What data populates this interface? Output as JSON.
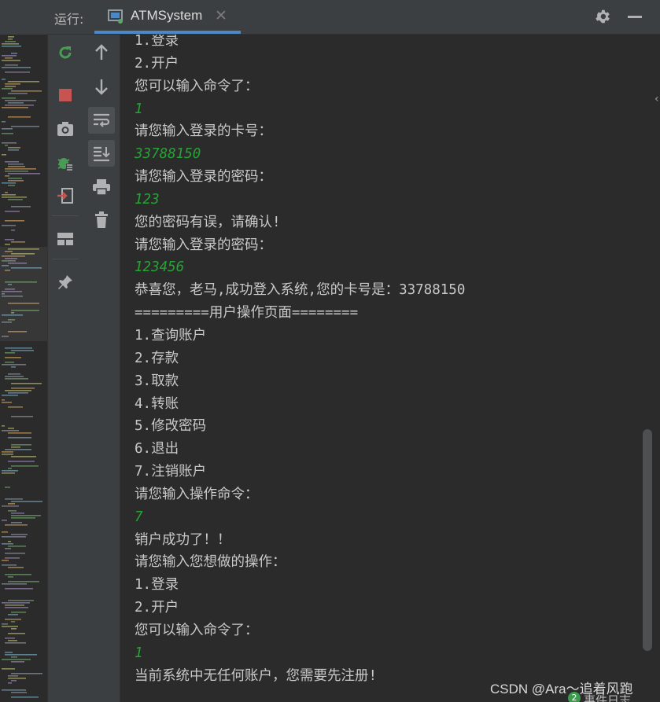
{
  "header": {
    "run_label": "运行:",
    "tab_title": "ATMSystem",
    "tab_close": "✕"
  },
  "icons": {
    "rerun": "rerun-icon",
    "stop": "stop-icon",
    "screenshot": "camera-icon",
    "debug": "debug-icon",
    "exit": "exit-icon",
    "layout": "layout-icon",
    "pin": "pin-icon",
    "up": "arrow-up-icon",
    "down": "arrow-down-icon",
    "soft_wrap": "soft-wrap-icon",
    "scroll_end": "scroll-to-end-icon",
    "print": "print-icon",
    "trash": "trash-icon",
    "settings": "gear-icon",
    "minimize": "minimize-icon"
  },
  "colors": {
    "output_text": "#c9c9c9",
    "user_input": "#26a334",
    "tab_accent": "#4a88c7",
    "stop_red": "#c75450",
    "rerun_green": "#499c54"
  },
  "console": {
    "lines": [
      {
        "kind": "out",
        "text": "1.登录"
      },
      {
        "kind": "out",
        "text": "2.开户"
      },
      {
        "kind": "out",
        "text": "您可以输入命令了："
      },
      {
        "kind": "in",
        "text": "1"
      },
      {
        "kind": "out",
        "text": "请您输入登录的卡号："
      },
      {
        "kind": "in",
        "text": "33788150"
      },
      {
        "kind": "out",
        "text": "请您输入登录的密码："
      },
      {
        "kind": "in",
        "text": "123"
      },
      {
        "kind": "out",
        "text": "您的密码有误，请确认!"
      },
      {
        "kind": "out",
        "text": "请您输入登录的密码："
      },
      {
        "kind": "in",
        "text": "123456"
      },
      {
        "kind": "out",
        "text": "恭喜您，老马,成功登入系统,您的卡号是：33788150"
      },
      {
        "kind": "out",
        "text": "=========用户操作页面========"
      },
      {
        "kind": "out",
        "text": "1.查询账户"
      },
      {
        "kind": "out",
        "text": "2.存款"
      },
      {
        "kind": "out",
        "text": "3.取款"
      },
      {
        "kind": "out",
        "text": "4.转账"
      },
      {
        "kind": "out",
        "text": "5.修改密码"
      },
      {
        "kind": "out",
        "text": "6.退出"
      },
      {
        "kind": "out",
        "text": "7.注销账户"
      },
      {
        "kind": "out",
        "text": "请您输入操作命令："
      },
      {
        "kind": "in",
        "text": "7"
      },
      {
        "kind": "out",
        "text": "销户成功了！！"
      },
      {
        "kind": "out",
        "text": "请您输入您想做的操作："
      },
      {
        "kind": "out",
        "text": "1.登录"
      },
      {
        "kind": "out",
        "text": "2.开户"
      },
      {
        "kind": "out",
        "text": "您可以输入命令了："
      },
      {
        "kind": "in",
        "text": "1"
      },
      {
        "kind": "out",
        "text": "当前系统中无任何账户，您需要先注册!"
      }
    ]
  },
  "footer": {
    "watermark": "CSDN @Ara～追着风跑",
    "event_badge": "2",
    "event_log": "事件日志"
  }
}
